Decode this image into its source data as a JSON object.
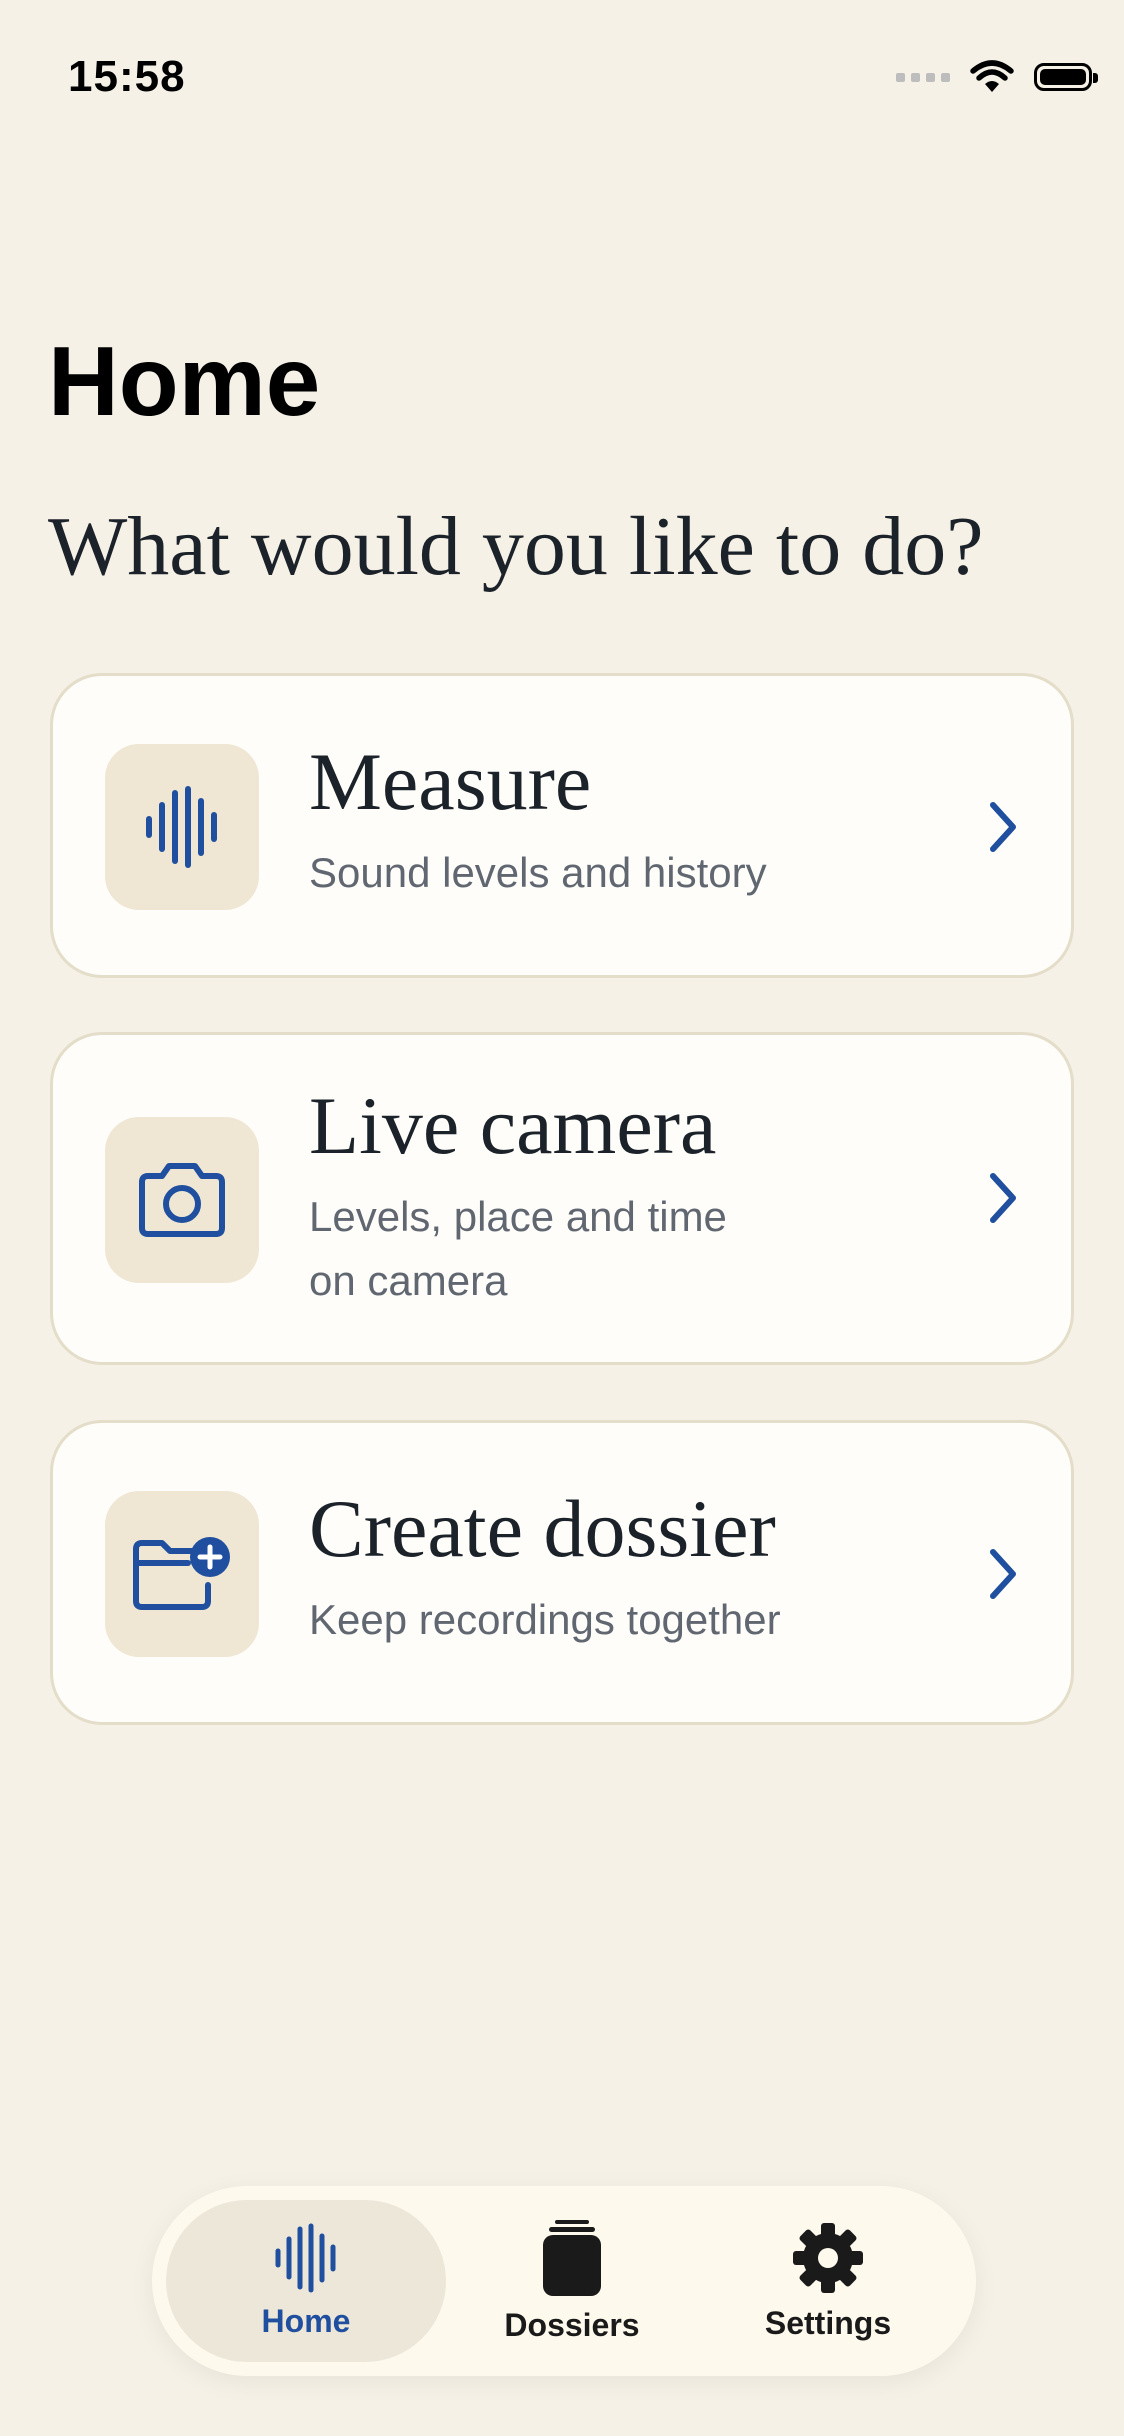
{
  "status_bar": {
    "time": "15:58"
  },
  "page": {
    "title": "Home",
    "prompt": "What would you like to do?"
  },
  "cards": [
    {
      "title": "Measure",
      "subtitle": "Sound levels and history",
      "icon": "sound-wave-icon"
    },
    {
      "title": "Live camera",
      "subtitle": "Levels, place and time on camera",
      "icon": "camera-icon"
    },
    {
      "title": "Create dossier",
      "subtitle": "Keep recordings together",
      "icon": "folder-plus-icon"
    }
  ],
  "tab_bar": {
    "items": [
      {
        "label": "Home",
        "icon": "sound-wave-icon",
        "active": true
      },
      {
        "label": "Dossiers",
        "icon": "stack-icon",
        "active": false
      },
      {
        "label": "Settings",
        "icon": "gear-icon",
        "active": false
      }
    ]
  },
  "colors": {
    "background": "#f5f1e6",
    "card_background": "#fefdf9",
    "accent": "#1f4f9e",
    "icon_tile": "#efe6d4",
    "title_text": "#1c2229",
    "secondary_text": "#616771",
    "tab_active_bg": "#ede7da"
  }
}
